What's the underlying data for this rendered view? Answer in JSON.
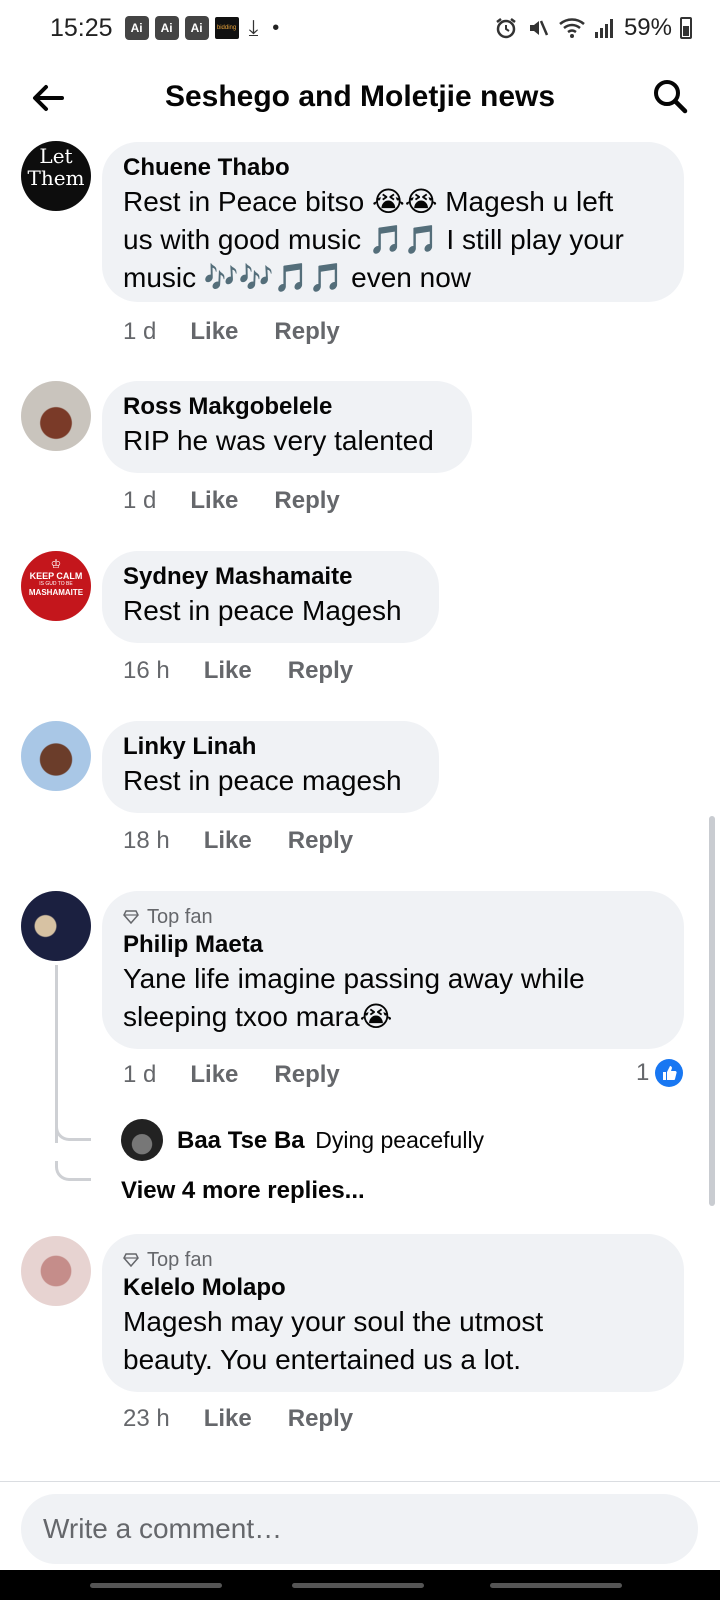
{
  "status_bar": {
    "time": "15:25",
    "ai_badges": [
      "Ai",
      "Ai",
      "Ai"
    ],
    "mini_app": "bidding",
    "battery": "59%",
    "icons": [
      "download-icon",
      "alarm-icon",
      "mute-icon",
      "wifi-icon",
      "signal-icon",
      "battery-icon"
    ]
  },
  "header": {
    "title": "Seshego and Moletjie news",
    "back_icon": "arrow-left-icon",
    "search_icon": "search-icon"
  },
  "comments": [
    {
      "author": "Chuene Thabo",
      "lines": [
        "Rest in Peace bitso 😭😭 Magesh u left",
        "us with good music 🎵🎵 I still play your",
        "music 🎶🎶🎵🎵 even now"
      ],
      "time": "1 d",
      "like_label": "Like",
      "reply_label": "Reply",
      "avatar_text": [
        "Let",
        "Them"
      ]
    },
    {
      "author": "Ross Makgobelele",
      "lines": [
        "RIP he was very talented"
      ],
      "time": "1 d",
      "like_label": "Like",
      "reply_label": "Reply"
    },
    {
      "author": "Sydney Mashamaite",
      "lines": [
        "Rest in peace Magesh"
      ],
      "time": "16 h",
      "like_label": "Like",
      "reply_label": "Reply",
      "avatar_text": [
        "KEEP CALM",
        "IS GUD TO BE",
        "MASHAMAITE"
      ]
    },
    {
      "author": "Linky Linah",
      "lines": [
        "Rest in peace magesh"
      ],
      "time": "18 h",
      "like_label": "Like",
      "reply_label": "Reply"
    },
    {
      "badge": "Top fan",
      "author": "Philip Maeta",
      "lines": [
        "Yane life imagine passing away while",
        "sleeping txoo mara😭"
      ],
      "time": "1 d",
      "like_label": "Like",
      "reply_label": "Reply",
      "like_count": "1",
      "reply_preview": {
        "author": "Baa Tse Ba",
        "text": "Dying peacefully"
      },
      "more_replies": "View 4 more replies..."
    },
    {
      "badge": "Top fan",
      "author": "Kelelo Molapo",
      "lines": [
        "Magesh may your soul the utmost",
        "beauty. You entertained us a lot."
      ],
      "time": "23 h",
      "like_label": "Like",
      "reply_label": "Reply"
    }
  ],
  "composer": {
    "placeholder": "Write a comment…"
  },
  "colors": {
    "bubble": "#f0f2f5",
    "meta_text": "#65676b",
    "like_blue": "#1877f2"
  }
}
